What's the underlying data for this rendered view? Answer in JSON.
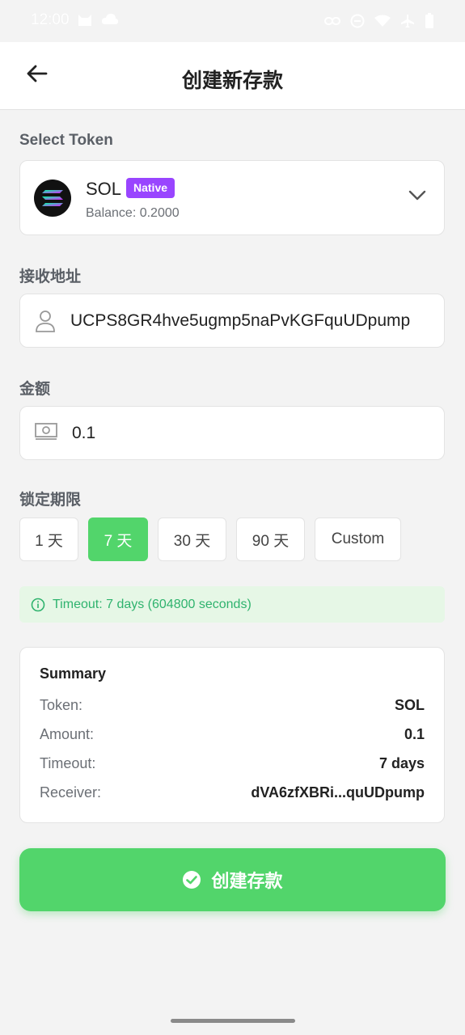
{
  "status_bar": {
    "time": "12:00",
    "icons": [
      "cat-icon",
      "cloud-icon",
      "link-icon",
      "do-not-disturb-icon",
      "wifi-icon",
      "airplane-icon",
      "battery-icon"
    ]
  },
  "app_bar": {
    "back_icon": "arrow-left-icon",
    "title": "创建新存款"
  },
  "token_section": {
    "label": "Select Token",
    "token_name": "SOL",
    "badge": "Native",
    "balance": "Balance: 0.2000",
    "chevron_icon": "chevron-down-icon"
  },
  "receiver_section": {
    "label": "接收地址",
    "icon": "user-icon",
    "value": "UCPS8GR4hve5ugmp5naPvKGFquUDpump"
  },
  "amount_section": {
    "label": "金额",
    "icon": "money-icon",
    "value": "0.1"
  },
  "lock_period": {
    "label": "锁定期限",
    "options": [
      "1 天",
      "7 天",
      "30 天",
      "90 天",
      "Custom"
    ],
    "selected": "7 天"
  },
  "timeout_info": {
    "icon": "info-icon",
    "text": "Timeout: 7 days (604800 seconds)"
  },
  "summary": {
    "title": "Summary",
    "rows": [
      {
        "key": "Token:",
        "value": "SOL"
      },
      {
        "key": "Amount:",
        "value": "0.1"
      },
      {
        "key": "Timeout:",
        "value": "7 days"
      },
      {
        "key": "Receiver:",
        "value": "dVA6zfXBRi...quUDpump"
      }
    ]
  },
  "submit": {
    "icon": "check-circle-icon",
    "label": "创建存款"
  },
  "colors": {
    "primary": "#52d56b",
    "badge": "#9945ff",
    "info_text": "#2fb36e",
    "info_bg": "#e6f7e6"
  }
}
